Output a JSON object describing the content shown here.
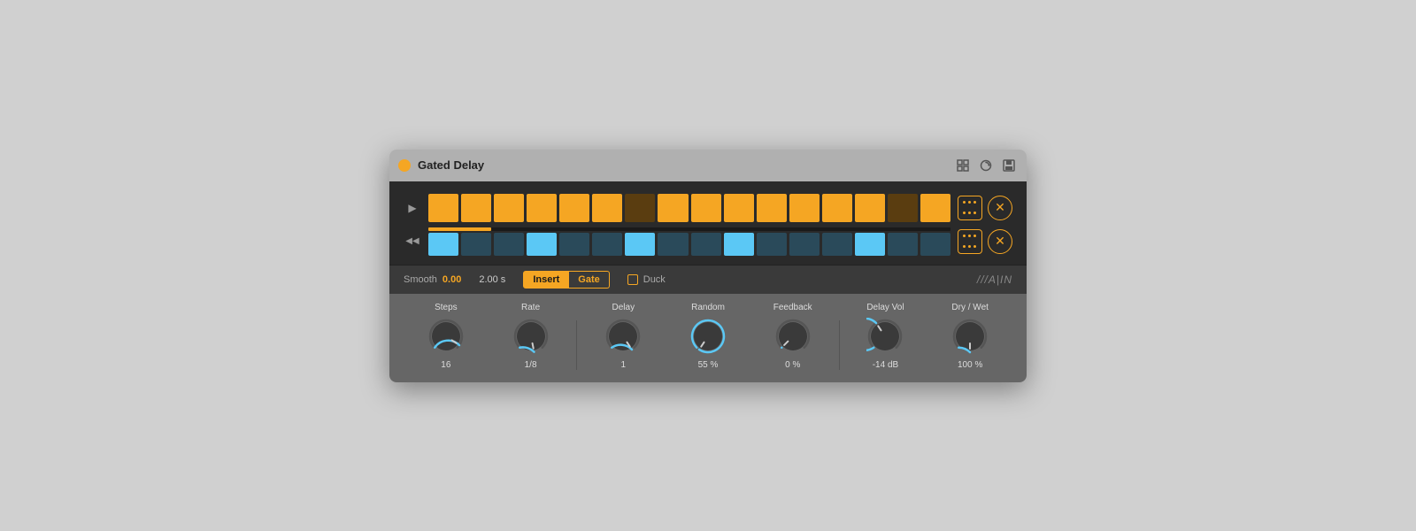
{
  "window": {
    "title": "Gated Delay",
    "accent_color": "#f5a623",
    "cyan_color": "#5bc8f5"
  },
  "title_bar": {
    "title": "Gated Delay",
    "icons": [
      "resize-icon",
      "refresh-icon",
      "save-icon"
    ]
  },
  "sequencer": {
    "row1": {
      "icon": "▶",
      "cells": [
        "on",
        "on",
        "on",
        "on",
        "on",
        "on",
        "off",
        "on",
        "on",
        "on",
        "on",
        "on",
        "on",
        "on",
        "off",
        "on"
      ],
      "progress": 12
    },
    "row2": {
      "icon": "◀◀",
      "cells": [
        "on",
        "off",
        "off",
        "on",
        "off",
        "off",
        "on",
        "off",
        "off",
        "on",
        "off",
        "off",
        "off",
        "on",
        "off",
        "off"
      ]
    }
  },
  "bottom_bar": {
    "smooth_label": "Smooth",
    "smooth_value": "0.00",
    "time_value": "2.00 s",
    "mode_insert": "Insert",
    "mode_gate": "Gate",
    "duck_label": "Duck",
    "brand": "///A|IN"
  },
  "knobs": [
    {
      "label": "Steps",
      "value": "16",
      "angle": -30,
      "color": "#5bc8f5"
    },
    {
      "label": "Rate",
      "value": "1/8",
      "angle": -10,
      "color": "#5bc8f5"
    },
    {
      "label": "Delay",
      "value": "1",
      "angle": -20,
      "color": "#5bc8f5"
    },
    {
      "label": "Random",
      "value": "55 %",
      "angle": 10,
      "color": "#5bc8f5"
    },
    {
      "label": "Feedback",
      "value": "0 %",
      "angle": -145,
      "color": "#5bc8f5"
    },
    {
      "label": "Delay Vol",
      "value": "-14 dB",
      "angle": 60,
      "color": "#5bc8f5"
    },
    {
      "label": "Dry / Wet",
      "value": "100 %",
      "angle": -5,
      "color": "#5bc8f5"
    }
  ]
}
